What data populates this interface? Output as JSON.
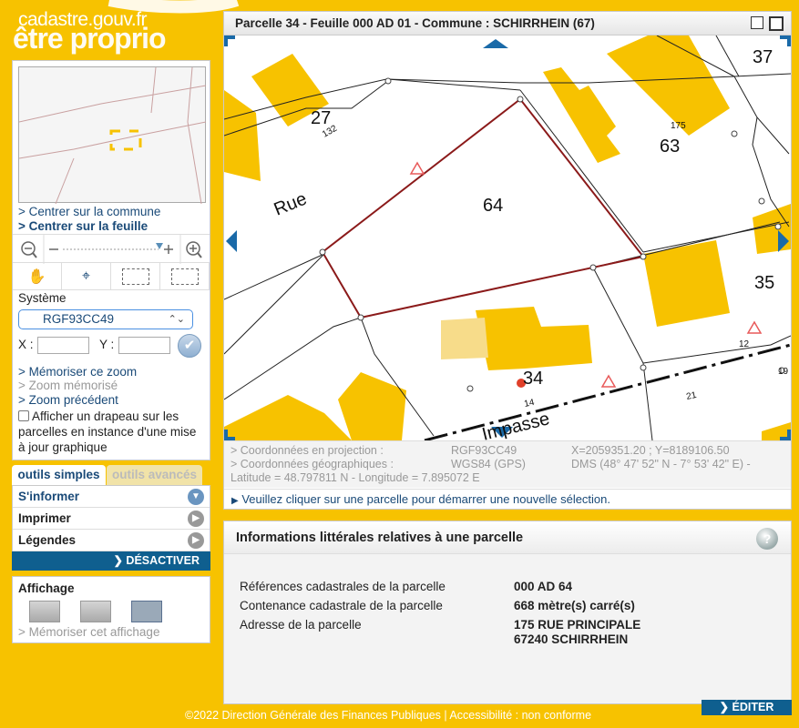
{
  "logo": {
    "line1": "cadastre.gouv.fr",
    "line2": "être proprio"
  },
  "sidebar": {
    "links": {
      "center_commune": "> Centrer sur la commune",
      "center_sheet": "> Centrer sur la feuille"
    },
    "system_label": "Système",
    "system_value": "RGF93CC49",
    "x_label": "X :",
    "y_label": "Y :",
    "zoom_links": {
      "save": "> Mémoriser ce zoom",
      "memorized": "> Zoom mémorisé",
      "previous": "> Zoom précédent"
    },
    "flag_checkbox": "Afficher un drapeau sur les parcelles en instance d'une mise à jour graphique"
  },
  "tabs": {
    "simple": "outils simples",
    "advanced": "outils avancés"
  },
  "menu": {
    "inform": "S'informer",
    "print": "Imprimer",
    "legends": "Légendes",
    "deactivate": "DÉSACTIVER"
  },
  "display": {
    "title": "Affichage",
    "save": "> Mémoriser cet affichage"
  },
  "map": {
    "title": "Parcelle 34 - Feuille 000 AD 01 - Commune : SCHIRRHEIN (67)",
    "labels": {
      "p27": "27",
      "p37": "37",
      "p63": "63",
      "p64": "64",
      "p35": "35",
      "p34": "34",
      "n132": "132",
      "n175": "175",
      "n12": "12",
      "n19": "19",
      "n14": "14",
      "n21": "21",
      "street1": "Rue",
      "street2": "Impasse"
    }
  },
  "coords": {
    "proj_label": "> Coordonnées en projection :",
    "proj_system": "RGF93CC49",
    "proj_value": "X=2059351.20 ; Y=8189106.50",
    "geo_label": "> Coordonnées géographiques :",
    "geo_system": "WGS84 (GPS)",
    "geo_value": "DMS (48° 47' 52\" N - 7° 53' 42\" E) -",
    "latlon": "Latitude = 48.797811 N - Longitude = 7.895072 E"
  },
  "hint": "Veuillez cliquer sur une parcelle pour démarrer une nouvelle sélection.",
  "info": {
    "title": "Informations littérales relatives à une parcelle",
    "rows": [
      {
        "label": "Références cadastrales de la parcelle",
        "value": "000 AD 64"
      },
      {
        "label": "Contenance cadastrale de la parcelle",
        "value": "668 mètre(s) carré(s)"
      },
      {
        "label": "Adresse de la parcelle",
        "value": "175 RUE PRINCIPALE",
        "value2": "67240 SCHIRRHEIN"
      }
    ],
    "edit": "ÉDITER"
  },
  "footer": "©2022 Direction Générale des Finances Publiques  |   Accessibilité : non conforme",
  "colors": {
    "accent": "#f7c200",
    "building": "#f7c200",
    "parcel_outline": "#8b1a1a",
    "link": "#1a4a78",
    "button": "#0f5f8f"
  }
}
